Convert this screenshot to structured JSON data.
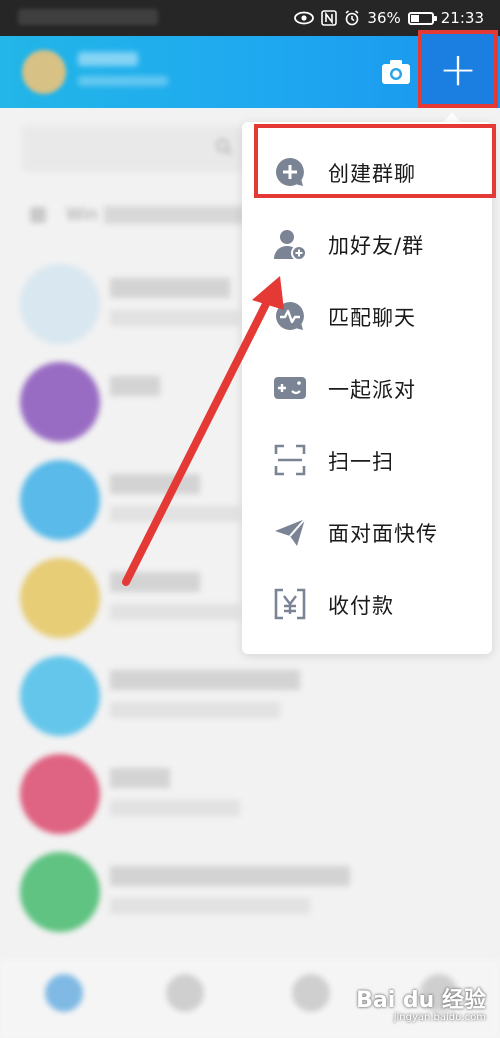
{
  "status_bar": {
    "battery": "36%",
    "time": "21:33"
  },
  "header": {
    "camera_icon": "camera-icon",
    "plus_label": "+"
  },
  "background_list": {
    "pinned_label": "Win"
  },
  "menu": {
    "items": [
      {
        "label": "创建群聊",
        "icon": "create-group-chat-icon"
      },
      {
        "label": "加好友/群",
        "icon": "add-friend-icon"
      },
      {
        "label": "匹配聊天",
        "icon": "match-chat-icon"
      },
      {
        "label": "一起派对",
        "icon": "party-icon"
      },
      {
        "label": "扫一扫",
        "icon": "scan-icon"
      },
      {
        "label": "面对面快传",
        "icon": "face-to-face-transfer-icon"
      },
      {
        "label": "收付款",
        "icon": "payment-icon"
      }
    ],
    "highlighted_item": "创建群聊"
  },
  "watermark": {
    "logo_text": "Bai du 经验",
    "url_text": "jingyan.baidu.com"
  },
  "colors": {
    "header_start": "#23b6e8",
    "header_end": "#1b94ee",
    "annotation_red": "#e53935",
    "icon_gray": "#7a8494"
  }
}
